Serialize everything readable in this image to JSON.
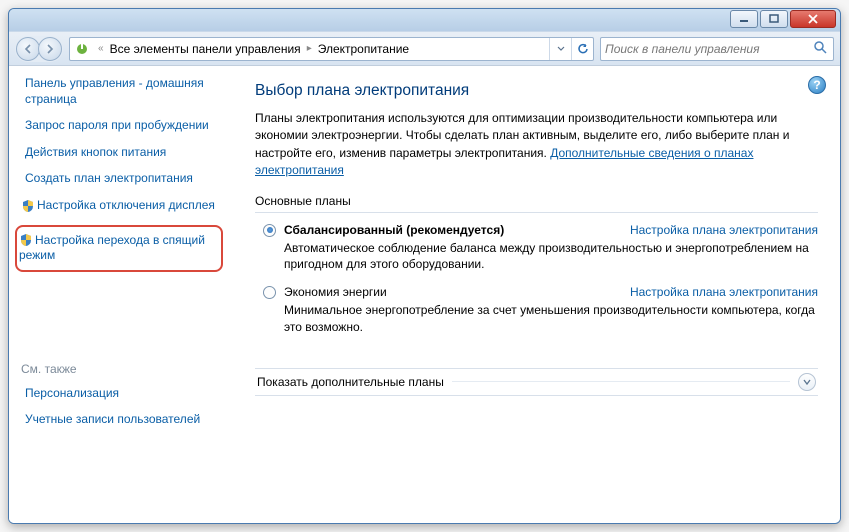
{
  "breadcrumb": {
    "part1": "Все элементы панели управления",
    "part2": "Электропитание"
  },
  "search": {
    "placeholder": "Поиск в панели управления"
  },
  "sidebar": {
    "home": "Панель управления - домашняя страница",
    "items": [
      "Запрос пароля при пробуждении",
      "Действия кнопок питания",
      "Создать план электропитания",
      "Настройка отключения дисплея",
      "Настройка перехода в спящий режим"
    ],
    "seealso_title": "См. также",
    "seealso": [
      "Персонализация",
      "Учетные записи пользователей"
    ]
  },
  "main": {
    "title": "Выбор плана электропитания",
    "intro_text": "Планы электропитания используются для оптимизации производительности компьютера или экономии электроэнергии. Чтобы сделать план активным, выделите его, либо выберите план и настройте его, изменив параметры электропитания. ",
    "intro_link": "Дополнительные сведения о планах электропитания",
    "section_label": "Основные планы",
    "plans": [
      {
        "name": "Сбалансированный (рекомендуется)",
        "link": "Настройка плана электропитания",
        "desc": "Автоматическое соблюдение баланса между производительностью и энергопотреблением на пригодном для этого оборудовании."
      },
      {
        "name": "Экономия энергии",
        "link": "Настройка плана электропитания",
        "desc": "Минимальное энергопотребление за счет уменьшения производительности компьютера, когда это возможно."
      }
    ],
    "expander": "Показать дополнительные планы"
  }
}
